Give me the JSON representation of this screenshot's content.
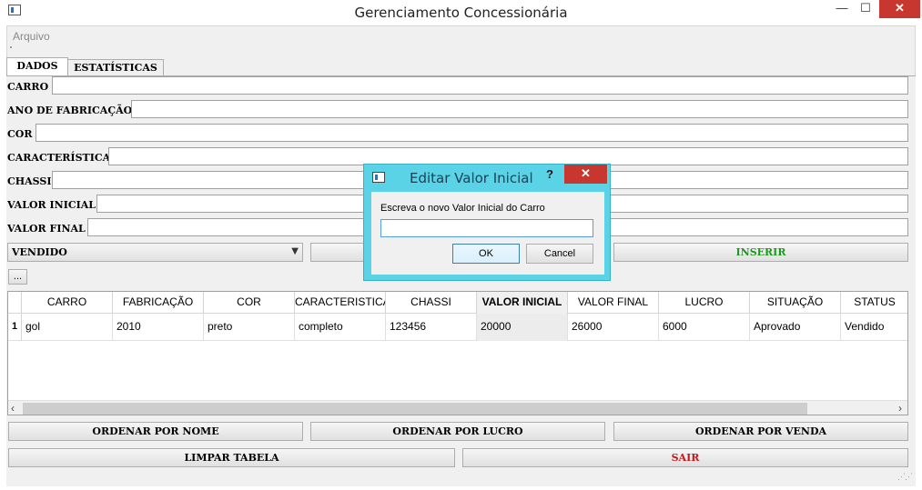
{
  "window": {
    "title": "Gerenciamento Concessionária",
    "minimize": "—",
    "maximize": "☐",
    "close": "✕"
  },
  "menu": {
    "arquivo": "Arquivo"
  },
  "tabs": {
    "dados": "DADOS",
    "estatisticas": "ESTATÍSTICAS"
  },
  "form": {
    "carro": "CARRO",
    "ano": "ANO DE FABRICAÇÃO",
    "cor": "COR",
    "caracteristica": "CARACTERÍSTICA",
    "chassi": "CHASSI",
    "valor_inicial": "VALOR INICIAL",
    "valor_final": "VALOR FINAL",
    "status_select": "VENDIDO",
    "inserir": "INSERIR",
    "ellipsis": "..."
  },
  "table": {
    "headers": [
      "CARRO",
      "FABRICAÇÃO",
      "COR",
      "CARACTERISTICA",
      "CHASSI",
      "VALOR INICIAL",
      "VALOR FINAL",
      "LUCRO",
      "SITUAÇÃO",
      "STATUS"
    ],
    "rows": [
      {
        "num": "1",
        "cells": [
          "gol",
          "2010",
          "preto",
          "completo",
          "123456",
          "20000",
          "26000",
          "6000",
          "Aprovado",
          "Vendido"
        ]
      }
    ],
    "scroll_left": "‹",
    "scroll_right": "›"
  },
  "buttons": {
    "ordenar_nome": "ORDENAR POR NOME",
    "ordenar_lucro": "ORDENAR POR LUCRO",
    "ordenar_venda": "ORDENAR POR VENDA",
    "limpar": "LIMPAR TABELA",
    "sair": "SAIR"
  },
  "dialog": {
    "title": "Editar Valor Inicial",
    "help": "?",
    "close": "✕",
    "prompt": "Escreva o novo Valor Inicial do Carro",
    "input_value": "",
    "ok": "OK",
    "cancel": "Cancel"
  },
  "colors": {
    "inserir": "#1a9a1a",
    "sair": "#c8161d",
    "dialog_frame": "#5ad3e6",
    "close_button": "#c7372f"
  }
}
